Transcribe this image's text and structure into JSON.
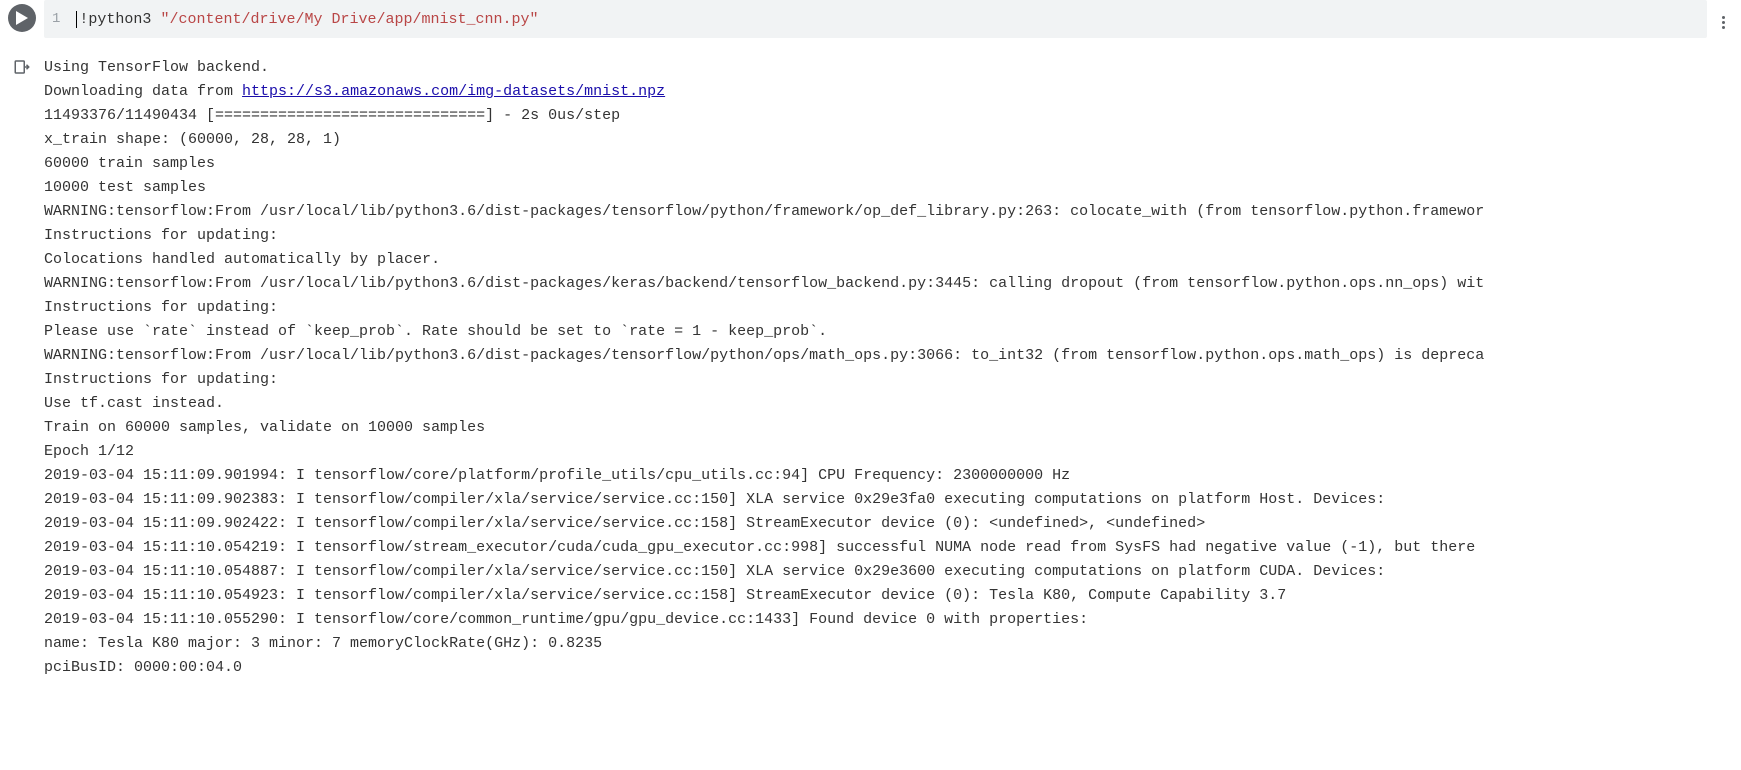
{
  "code": {
    "line_number": "1",
    "bang": "!",
    "command": "python3 ",
    "path": "\"/content/drive/My Drive/app/mnist_cnn.py\""
  },
  "output": {
    "line1": "Using TensorFlow backend.",
    "line2_prefix": "Downloading data from ",
    "line2_link": "https://s3.amazonaws.com/img-datasets/mnist.npz",
    "line3": "11493376/11490434 [==============================] - 2s 0us/step",
    "line4": "x_train shape: (60000, 28, 28, 1)",
    "line5": "60000 train samples",
    "line6": "10000 test samples",
    "line7": "WARNING:tensorflow:From /usr/local/lib/python3.6/dist-packages/tensorflow/python/framework/op_def_library.py:263: colocate_with (from tensorflow.python.framewor",
    "line8": "Instructions for updating:",
    "line9": "Colocations handled automatically by placer.",
    "line10": "WARNING:tensorflow:From /usr/local/lib/python3.6/dist-packages/keras/backend/tensorflow_backend.py:3445: calling dropout (from tensorflow.python.ops.nn_ops) wit",
    "line11": "Instructions for updating:",
    "line12": "Please use `rate` instead of `keep_prob`. Rate should be set to `rate = 1 - keep_prob`.",
    "line13": "WARNING:tensorflow:From /usr/local/lib/python3.6/dist-packages/tensorflow/python/ops/math_ops.py:3066: to_int32 (from tensorflow.python.ops.math_ops) is depreca",
    "line14": "Instructions for updating:",
    "line15": "Use tf.cast instead.",
    "line16": "Train on 60000 samples, validate on 10000 samples",
    "line17": "Epoch 1/12",
    "line18": "2019-03-04 15:11:09.901994: I tensorflow/core/platform/profile_utils/cpu_utils.cc:94] CPU Frequency: 2300000000 Hz",
    "line19": "2019-03-04 15:11:09.902383: I tensorflow/compiler/xla/service/service.cc:150] XLA service 0x29e3fa0 executing computations on platform Host. Devices:",
    "line20": "2019-03-04 15:11:09.902422: I tensorflow/compiler/xla/service/service.cc:158]   StreamExecutor device (0): <undefined>, <undefined>",
    "line21": "2019-03-04 15:11:10.054219: I tensorflow/stream_executor/cuda/cuda_gpu_executor.cc:998] successful NUMA node read from SysFS had negative value (-1), but there ",
    "line22": "2019-03-04 15:11:10.054887: I tensorflow/compiler/xla/service/service.cc:150] XLA service 0x29e3600 executing computations on platform CUDA. Devices:",
    "line23": "2019-03-04 15:11:10.054923: I tensorflow/compiler/xla/service/service.cc:158]   StreamExecutor device (0): Tesla K80, Compute Capability 3.7",
    "line24": "2019-03-04 15:11:10.055290: I tensorflow/core/common_runtime/gpu/gpu_device.cc:1433] Found device 0 with properties:",
    "line25": "name: Tesla K80 major: 3 minor: 7 memoryClockRate(GHz): 0.8235",
    "line26": "pciBusID: 0000:00:04.0"
  }
}
